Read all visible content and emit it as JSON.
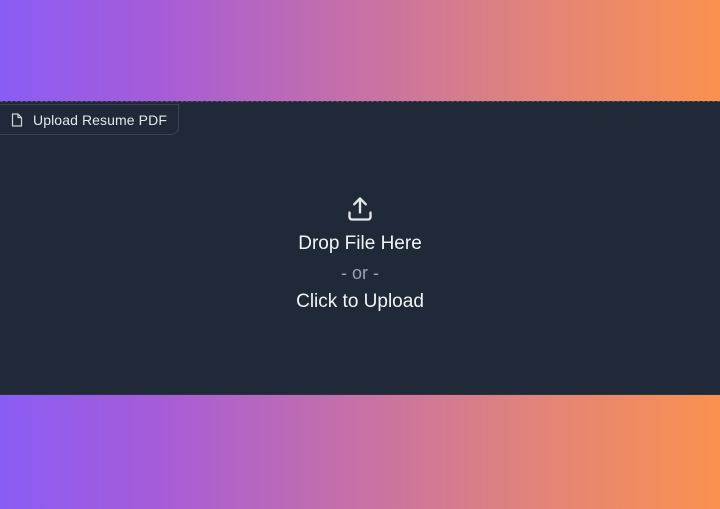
{
  "background": {
    "gradient_start": "#8a5cf6",
    "gradient_end": "#fb914f"
  },
  "upload_component": {
    "label": "Upload Resume PDF",
    "label_icon": "file-icon",
    "upload_icon": "upload-icon",
    "drop_text": "Drop File Here",
    "or_text": "- or -",
    "click_text": "Click to Upload",
    "panel_color": "#1f2937"
  }
}
